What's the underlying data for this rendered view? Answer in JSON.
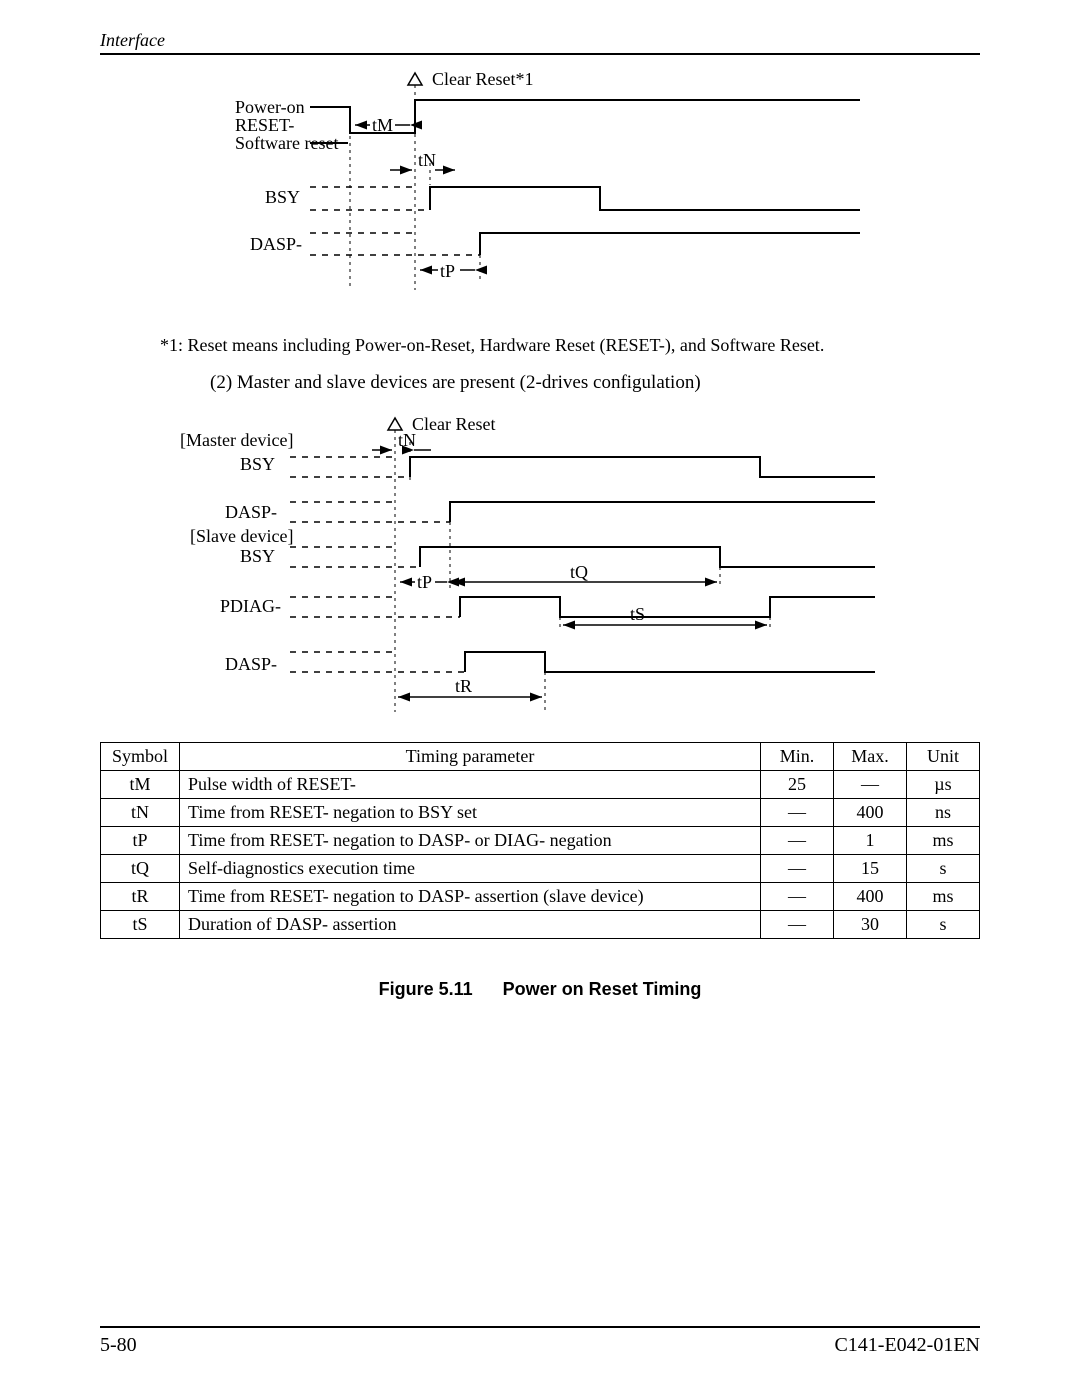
{
  "header": {
    "left": "Interface"
  },
  "footer": {
    "left": "5-80",
    "right": "C141-E042-01EN"
  },
  "diagram1": {
    "clear_reset": "Clear Reset*1",
    "labels": {
      "power_on": "Power-on",
      "reset": "RESET-",
      "sw_reset": "Software reset",
      "bsy": "BSY",
      "dasp": "DASP-"
    },
    "timing": {
      "tM": "tM",
      "tN": "tN",
      "tP": "tP"
    }
  },
  "note": "*1: Reset means including Power-on-Reset, Hardware Reset (RESET-), and Software Reset.",
  "subheading": "(2)  Master and slave devices are present (2-drives configulation)",
  "diagram2": {
    "clear_reset": "Clear Reset",
    "groups": {
      "master": "[Master device]",
      "slave": "[Slave device]"
    },
    "labels": {
      "bsy": "BSY",
      "dasp": "DASP-",
      "pdiag": "PDIAG-"
    },
    "timing": {
      "tN": "tN",
      "tP": "tP",
      "tQ": "tQ",
      "tS": "tS",
      "tR": "tR"
    }
  },
  "table": {
    "headers": {
      "symbol": "Symbol",
      "param": "Timing parameter",
      "min": "Min.",
      "max": "Max.",
      "unit": "Unit"
    },
    "rows": [
      {
        "sym": "tM",
        "param": "Pulse width of RESET-",
        "min": "25",
        "max": "—",
        "unit": "µs"
      },
      {
        "sym": "tN",
        "param": "Time from RESET- negation to BSY set",
        "min": "—",
        "max": "400",
        "unit": "ns"
      },
      {
        "sym": "tP",
        "param": "Time from RESET- negation to DASP- or DIAG- negation",
        "min": "—",
        "max": "1",
        "unit": "ms"
      },
      {
        "sym": "tQ",
        "param": "Self-diagnostics execution time",
        "min": "—",
        "max": "15",
        "unit": "s"
      },
      {
        "sym": "tR",
        "param": "Time from RESET- negation to DASP- assertion (slave device)",
        "min": "—",
        "max": "400",
        "unit": "ms"
      },
      {
        "sym": "tS",
        "param": "Duration of DASP- assertion",
        "min": "—",
        "max": "30",
        "unit": "s"
      }
    ]
  },
  "figure_caption": {
    "label": "Figure 5.11",
    "title": "Power on Reset Timing"
  }
}
